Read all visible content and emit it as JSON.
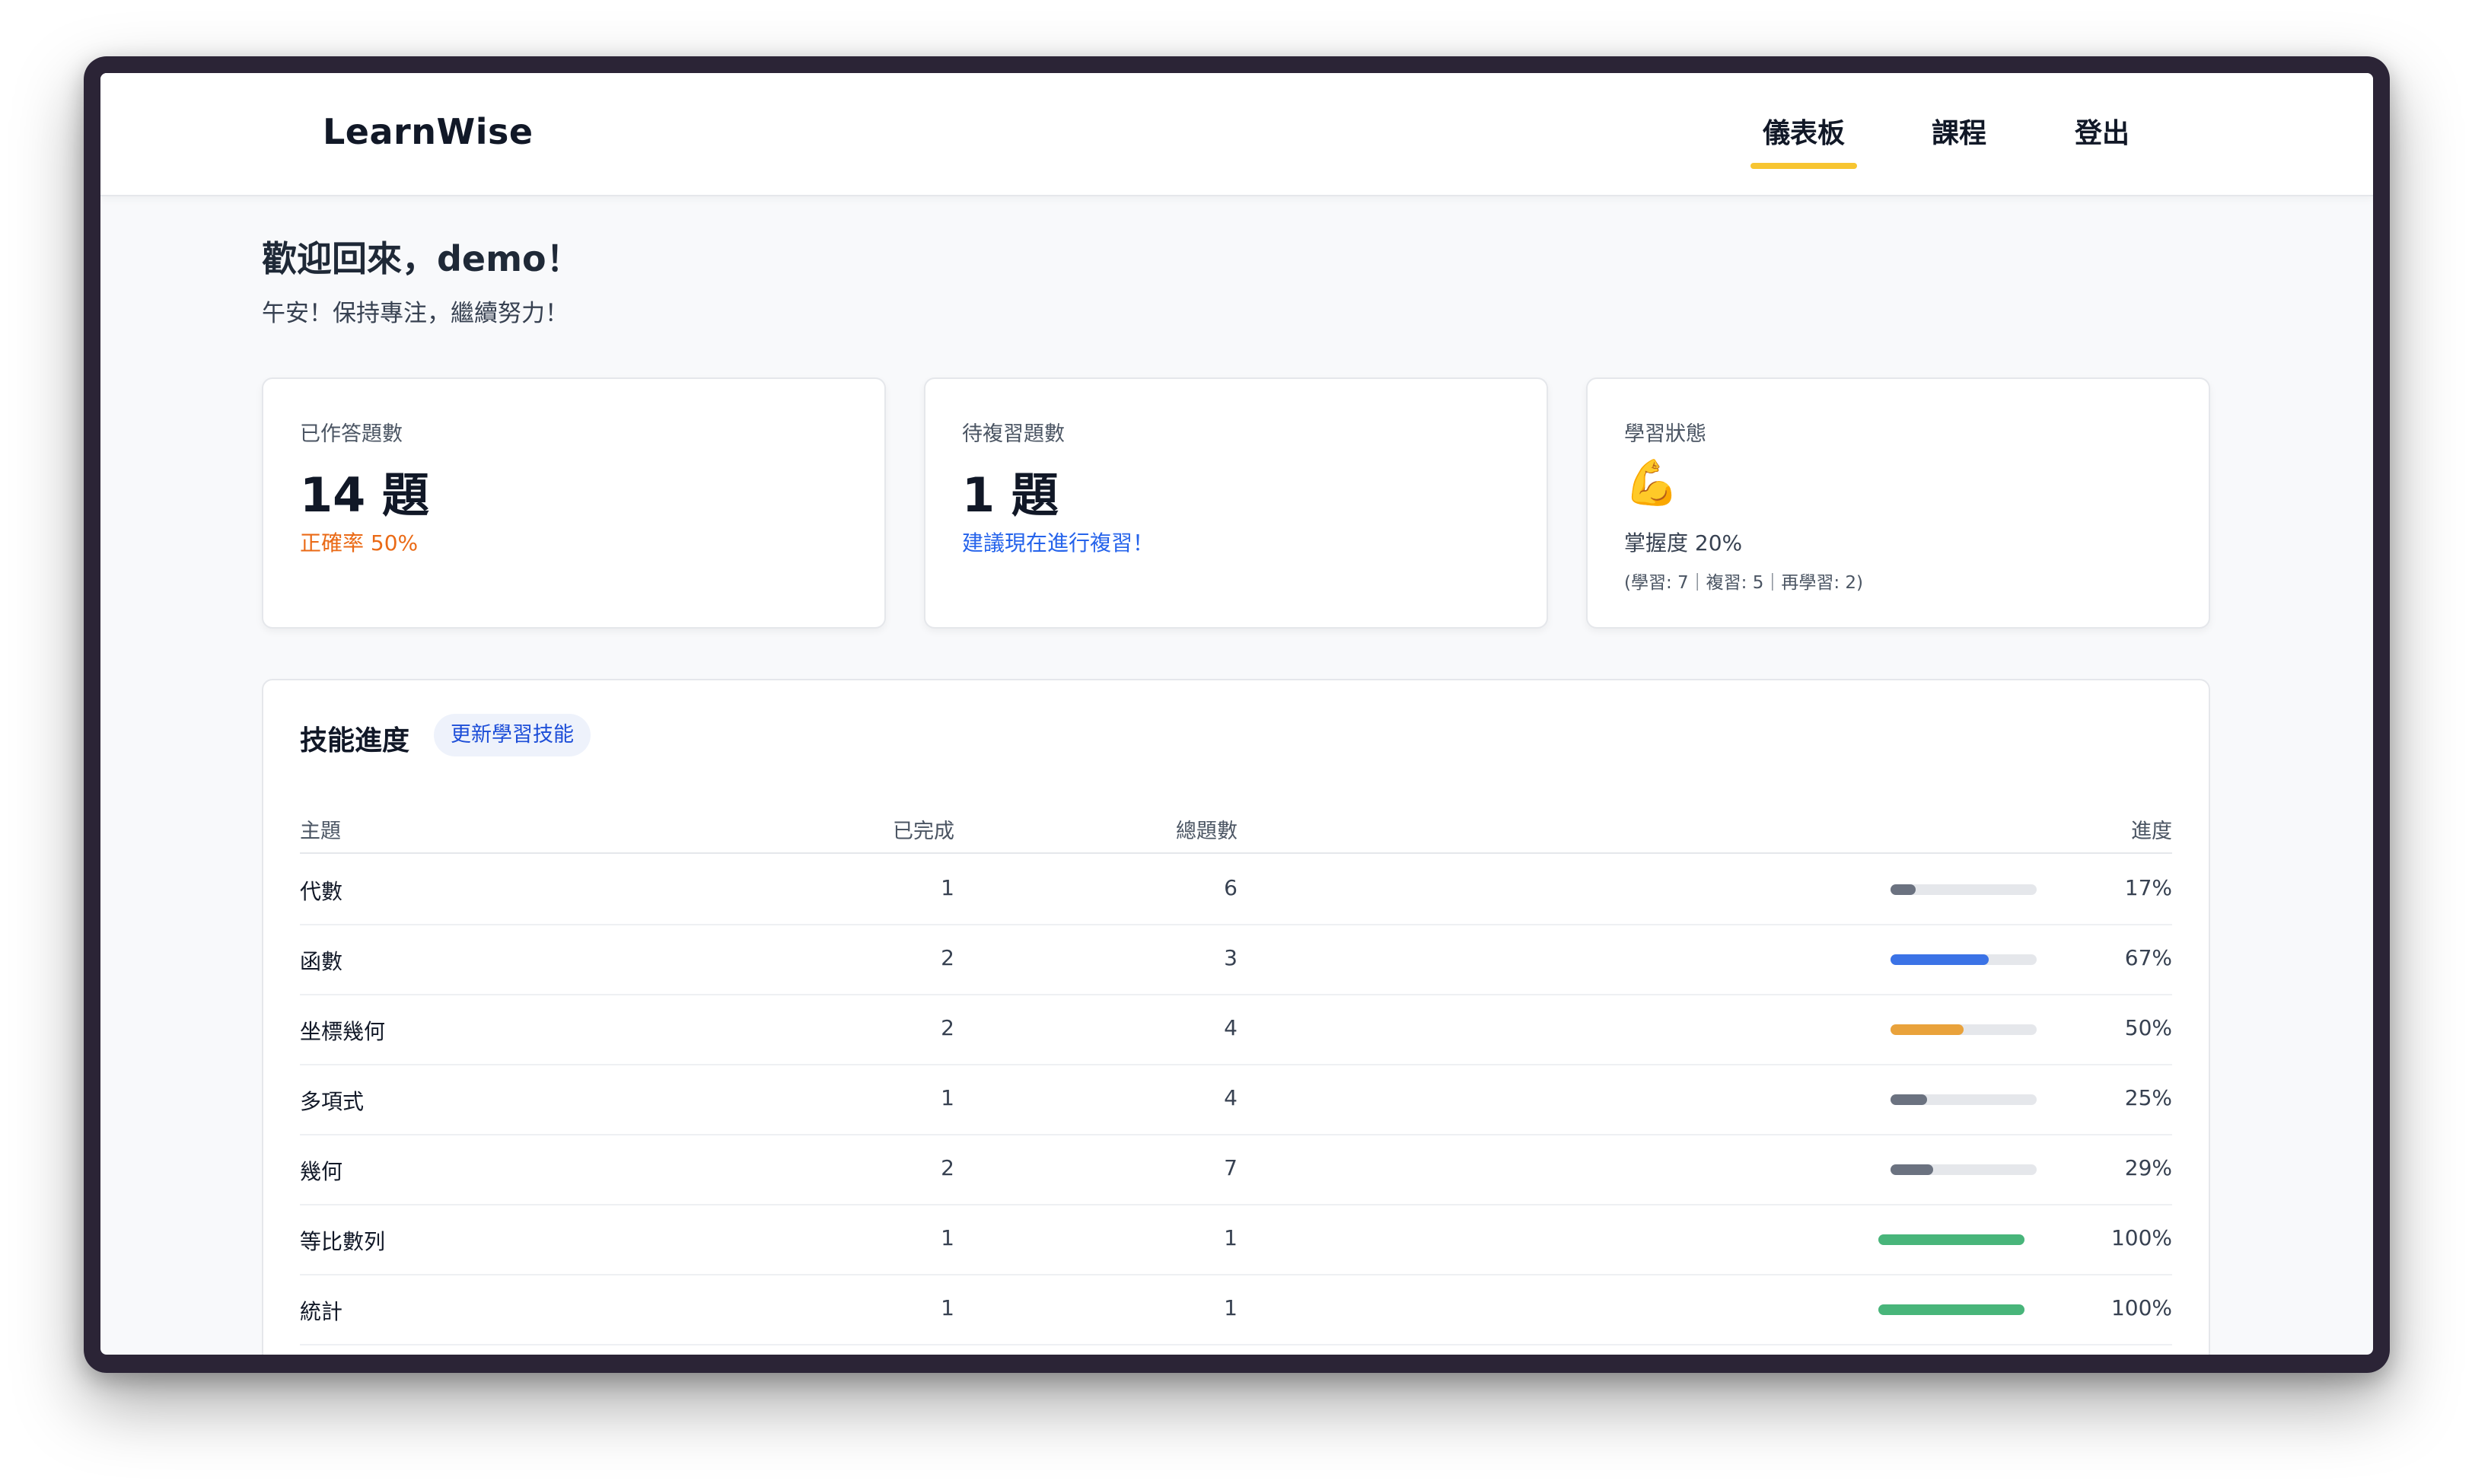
{
  "header": {
    "brand": "LearnWise",
    "nav": [
      {
        "label": "儀表板",
        "active": true
      },
      {
        "label": "課程",
        "active": false
      },
      {
        "label": "登出",
        "active": false
      }
    ],
    "accent_color": "#f7c531"
  },
  "welcome": {
    "title": "歡迎回來，demo！",
    "subtitle": "午安！保持專注，繼續努力！"
  },
  "stats": {
    "answered": {
      "label": "已作答題數",
      "value": "14 題",
      "note": "正確率 50%"
    },
    "review": {
      "label": "待複習題數",
      "value": "1 題",
      "note": "建議現在進行複習！"
    },
    "status": {
      "label": "學習狀態",
      "emoji": "💪",
      "mastery": "掌握度 20%",
      "detail": "(學習: 7｜複習: 5｜再學習: 2)"
    }
  },
  "skills": {
    "title": "技能進度",
    "update_button": "更新學習技能",
    "columns": {
      "topic": "主題",
      "done": "已完成",
      "total": "總題數",
      "progress": "進度"
    },
    "rows": [
      {
        "topic": "代數",
        "done": "1",
        "total": "6",
        "progress": 0.17,
        "pct": "17%",
        "color": "#6b7280"
      },
      {
        "topic": "函數",
        "done": "2",
        "total": "3",
        "progress": 0.67,
        "pct": "67%",
        "color": "#3b73e6"
      },
      {
        "topic": "坐標幾何",
        "done": "2",
        "total": "4",
        "progress": 0.5,
        "pct": "50%",
        "color": "#e9a23b"
      },
      {
        "topic": "多項式",
        "done": "1",
        "total": "4",
        "progress": 0.25,
        "pct": "25%",
        "color": "#6b7280"
      },
      {
        "topic": "幾何",
        "done": "2",
        "total": "7",
        "progress": 0.29,
        "pct": "29%",
        "color": "#6b7280"
      },
      {
        "topic": "等比數列",
        "done": "1",
        "total": "1",
        "progress": 1.0,
        "pct": "100%",
        "color": "#48b57a"
      },
      {
        "topic": "統計",
        "done": "1",
        "total": "1",
        "progress": 1.0,
        "pct": "100%",
        "color": "#48b57a"
      }
    ]
  }
}
